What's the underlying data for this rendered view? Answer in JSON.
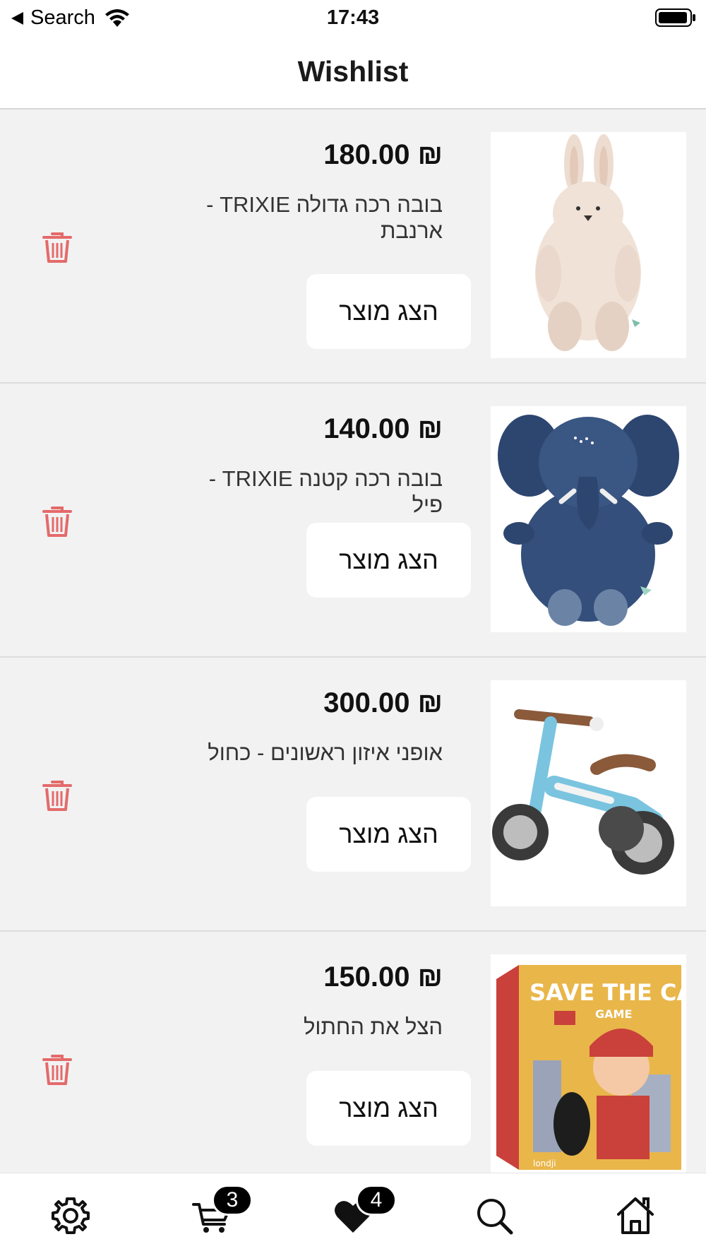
{
  "status_bar": {
    "back_label": "Search",
    "time": "17:43"
  },
  "header": {
    "title": "Wishlist"
  },
  "colors": {
    "trash": "#e46a6a",
    "background": "#f2f2f3",
    "badge": "#000000"
  },
  "items": [
    {
      "price": "₪ 180.00",
      "name": "בובה רכה גדולה TRIXIE - ארנבת",
      "button": "הצג מוצר",
      "image_icon": "bunny-plush"
    },
    {
      "price": "₪ 140.00",
      "name": "בובה רכה קטנה TRIXIE - פיל",
      "button": "הצג מוצר",
      "image_icon": "elephant-plush"
    },
    {
      "price": "₪ 300.00",
      "name": "אופני איזון ראשונים - כחול",
      "button": "הצג מוצר",
      "image_icon": "balance-bike"
    },
    {
      "price": "₪ 150.00",
      "name": "הצל את החתול",
      "button": "הצג מוצר",
      "image_icon": "save-the-cat-game"
    }
  ],
  "game_box": {
    "title": "SAVE THE CAT!",
    "subtitle": "GAME",
    "brand": "londji"
  },
  "tab_bar": {
    "cart_badge": "3",
    "wishlist_badge": "4",
    "icons": [
      "gear-icon",
      "cart-icon",
      "heart-icon",
      "search-icon",
      "home-icon"
    ]
  }
}
